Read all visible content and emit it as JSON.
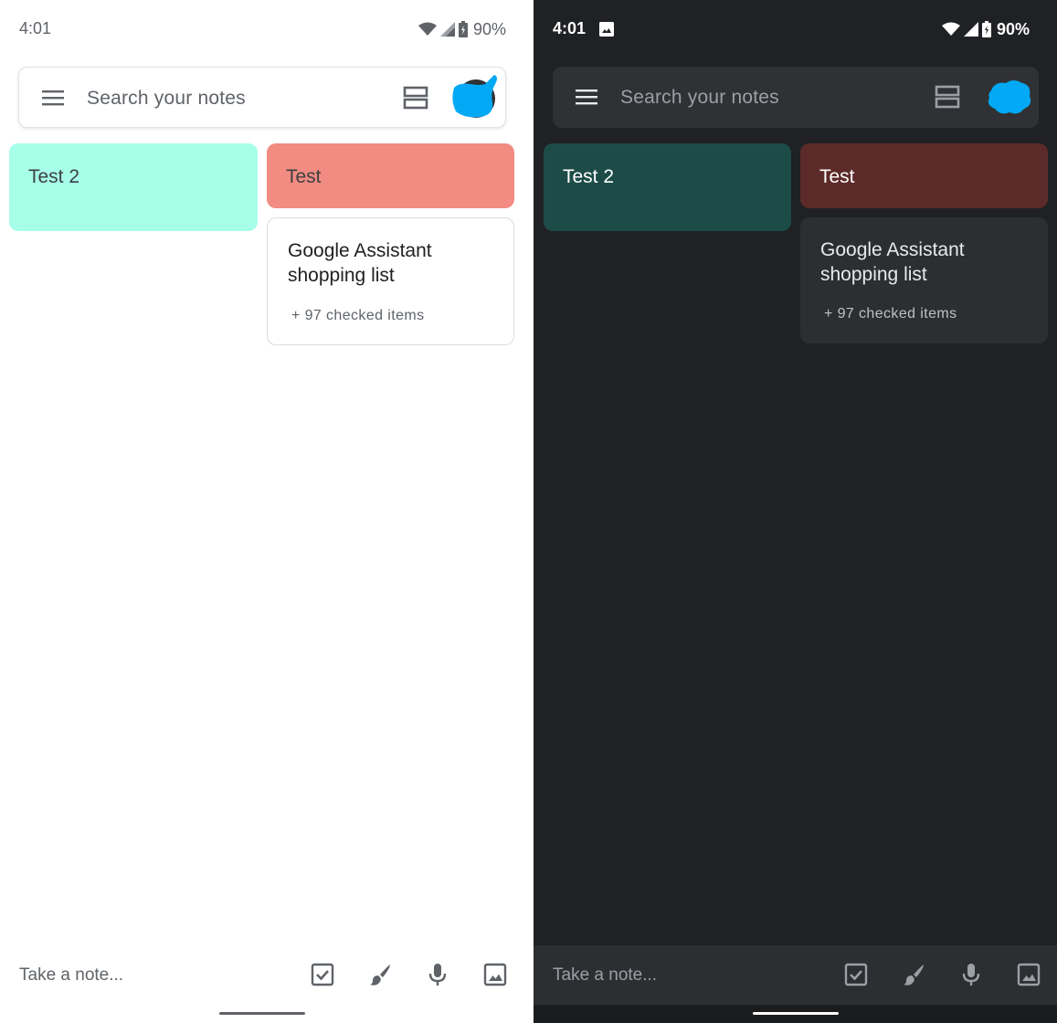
{
  "panels": {
    "light": {
      "status": {
        "time": "4:01",
        "battery": "90%"
      },
      "search": {
        "placeholder": "Search your notes"
      },
      "notes": [
        {
          "title": "Test 2",
          "color": "#a7fee9"
        },
        {
          "title": "Test",
          "color": "#f28b82"
        },
        {
          "title": "Google Assistant shopping list",
          "meta": "+ 97 checked items"
        }
      ],
      "bottom": {
        "take_note": "Take a note..."
      }
    },
    "dark": {
      "status": {
        "time": "4:01",
        "battery": "90%"
      },
      "search": {
        "placeholder": "Search your notes"
      },
      "notes": [
        {
          "title": "Test 2",
          "color": "#1d4c48"
        },
        {
          "title": "Test",
          "color": "#5c2b29"
        },
        {
          "title": "Google Assistant shopping list",
          "meta": "+ 97 checked items"
        }
      ],
      "bottom": {
        "take_note": "Take a note..."
      }
    }
  },
  "icons": [
    "menu-icon",
    "list-layout-icon",
    "avatar",
    "checkbox-icon",
    "brush-icon",
    "mic-icon",
    "image-icon",
    "wifi-icon",
    "signal-icon",
    "battery-icon"
  ],
  "colors": {
    "accent_avatar": "#03a9f4",
    "dark_background": "#202124"
  }
}
